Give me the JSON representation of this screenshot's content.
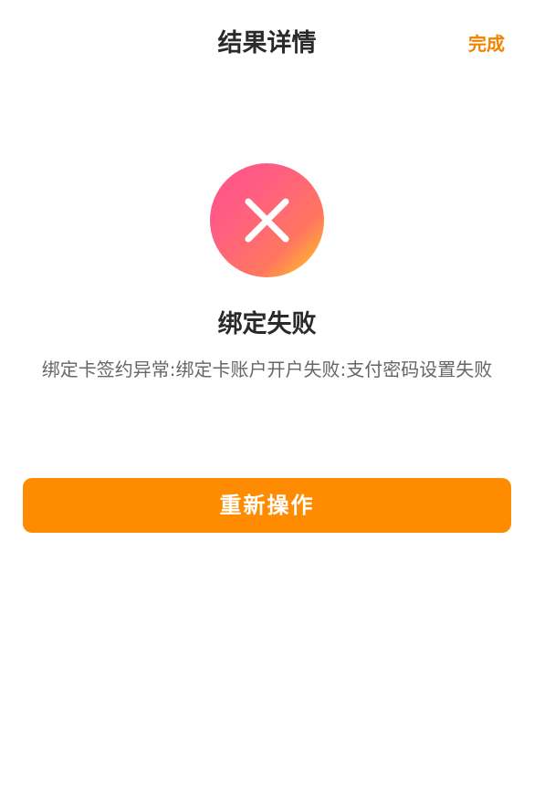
{
  "header": {
    "title": "结果详情",
    "done_label": "完成",
    "accent_color": "#f08300"
  },
  "result": {
    "status": "failure",
    "icon": "close-icon",
    "title": "绑定失败",
    "message": "绑定卡签约异常:绑定卡账户开户失败:支付密码设置失败"
  },
  "actions": {
    "retry_label": "重新操作",
    "button_color": "#ff8c00"
  }
}
